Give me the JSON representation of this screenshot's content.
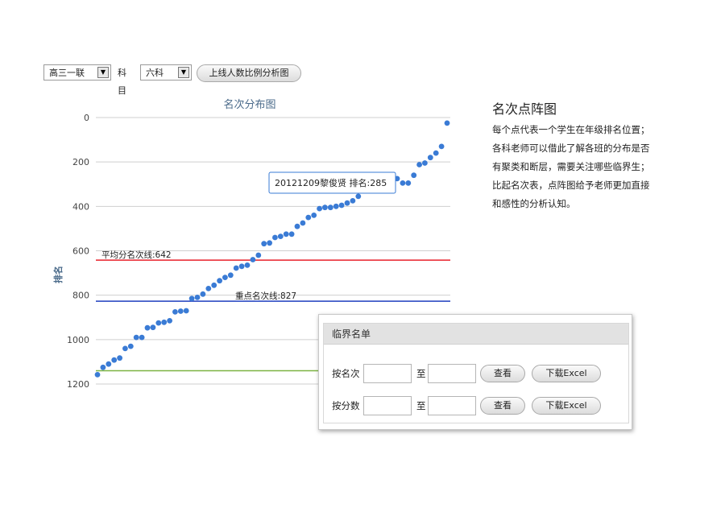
{
  "toolbar": {
    "grade_select": "高三一联",
    "subject_label": "科目",
    "subject_select": "六科",
    "analysis_button": "上线人数比例分析图"
  },
  "side": {
    "title": "名次点阵图",
    "lines": [
      "每个点代表一个学生在年级排名位置；",
      "各科老师可以借此了解各班的分布是否",
      "有聚类和断层，需要关注哪些临界生；",
      "比起名次表，点阵图给予老师更加直接",
      "和感性的分析认知。"
    ]
  },
  "panel": {
    "title": "临界名单",
    "row1_label": "按名次",
    "row2_label": "按分数",
    "to_label": "至",
    "view_button": "查看",
    "excel_button": "下载Excel"
  },
  "colors": {
    "series": "#3a7bd5",
    "average_line": "#e8202a",
    "key_line": "#1f3fbf",
    "bottom_line": "#7cb342",
    "tooltip_border": "#3a7bd5"
  },
  "chart_data": {
    "type": "scatter",
    "title": "名次分布图",
    "ylabel": "排名",
    "yticks": [
      "0",
      "200",
      "400",
      "600",
      "800",
      "1000",
      "1200"
    ],
    "ylim": [
      0,
      1200
    ],
    "y_inverted": true,
    "grid": true,
    "reference_lines": [
      {
        "label": "平均分名次线:642",
        "value": 642,
        "color": "#e8202a"
      },
      {
        "label": "重点名次线:827",
        "value": 827,
        "color": "#1f3fbf"
      },
      {
        "label": "",
        "value": 1140,
        "color": "#7cb342"
      }
    ],
    "tooltip": "20121209黎俊贤 排名:285",
    "series": [
      {
        "values": [
          1158,
          1125,
          1110,
          1092,
          1083,
          1040,
          1030,
          990,
          990,
          947,
          945,
          925,
          922,
          915,
          875,
          872,
          870,
          815,
          810,
          795,
          770,
          755,
          735,
          720,
          710,
          678,
          670,
          665,
          640,
          620,
          568,
          565,
          540,
          535,
          525,
          525,
          490,
          475,
          450,
          440,
          410,
          405,
          405,
          400,
          395,
          385,
          375,
          355,
          330,
          320,
          310,
          295,
          285,
          290,
          275,
          295,
          295,
          260,
          212,
          205,
          180,
          160,
          130,
          25
        ]
      }
    ]
  }
}
